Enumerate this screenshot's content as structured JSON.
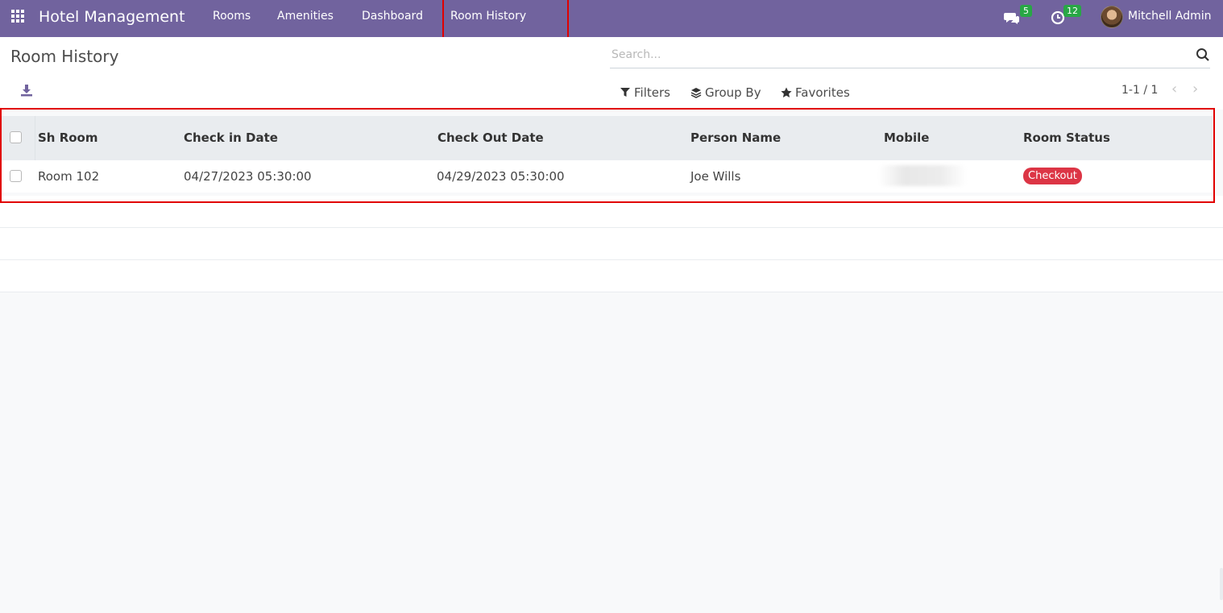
{
  "navbar": {
    "brand": "Hotel Management",
    "menu": [
      "Rooms",
      "Amenities",
      "Dashboard",
      "Room History"
    ],
    "chat_count": "5",
    "activity_count": "12",
    "user": "Mitchell Admin"
  },
  "control_panel": {
    "title": "Room History",
    "search_placeholder": "Search...",
    "filters_label": "Filters",
    "group_by_label": "Group By",
    "favorites_label": "Favorites",
    "pager": "1-1 / 1"
  },
  "table": {
    "columns": [
      "Sh Room",
      "Check in Date",
      "Check Out Date",
      "Person Name",
      "Mobile",
      "Room Status"
    ],
    "rows": [
      {
        "room": "Room 102",
        "check_in": "04/27/2023 05:30:00",
        "check_out": "04/29/2023 05:30:00",
        "person": "Joe Wills",
        "mobile": "",
        "status": "Checkout"
      }
    ]
  },
  "colors": {
    "navbar": "#71639e",
    "status_checkout": "#dc3545",
    "annotation": "#e10000"
  }
}
